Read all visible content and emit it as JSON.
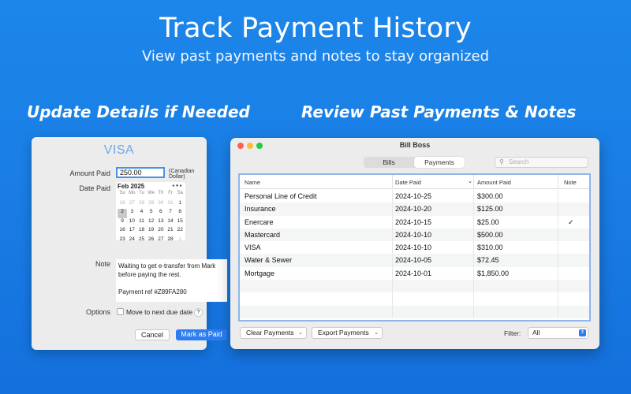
{
  "header": {
    "title": "Track Payment History",
    "subtitle": "View past payments and notes to stay organized"
  },
  "sections": {
    "left_title": "Update Details if Needed",
    "right_title": "Review Past Payments & Notes"
  },
  "details_panel": {
    "brand": "VISA",
    "amount_label": "Amount Paid",
    "amount_value": "250.00",
    "currency": "(Canadian Dollar)",
    "date_label": "Date Paid",
    "calendar": {
      "month": "Feb 2025",
      "nav": "◂ ● ▸",
      "weekdays": [
        "Su",
        "Mo",
        "Tu",
        "We",
        "Th",
        "Fr",
        "Sa"
      ],
      "days": [
        [
          "26",
          "27",
          "28",
          "29",
          "30",
          "31",
          "1"
        ],
        [
          "2",
          "3",
          "4",
          "5",
          "6",
          "7",
          "8"
        ],
        [
          "9",
          "10",
          "11",
          "12",
          "13",
          "14",
          "15"
        ],
        [
          "16",
          "17",
          "18",
          "19",
          "20",
          "21",
          "22"
        ],
        [
          "23",
          "24",
          "25",
          "26",
          "27",
          "28",
          "1"
        ]
      ],
      "selected_day": "2"
    },
    "note_label": "Note",
    "note_lines": [
      "Waiting to get e-transfer from Mark",
      "before paying the rest.",
      "",
      "Payment ref #Z89FA280"
    ],
    "options_label": "Options",
    "move_checkbox_label": "Move to next due date",
    "move_checked": false,
    "help_label": "?",
    "cancel_label": "Cancel",
    "mark_paid_label": "Mark as Paid"
  },
  "window": {
    "title": "Bill Boss",
    "tabs": [
      {
        "label": "Bills",
        "active": false
      },
      {
        "label": "Payments",
        "active": true
      }
    ],
    "search_placeholder": "Search",
    "search_icon": "magnifier-icon",
    "columns": [
      "Name",
      "Date Paid",
      "Amount Paid",
      "Note"
    ],
    "sort_indicator": "⌄",
    "rows": [
      {
        "name": "Personal Line of Credit",
        "date": "2024-10-25",
        "amount": "$300.00",
        "note": ""
      },
      {
        "name": "Insurance",
        "date": "2024-10-20",
        "amount": "$125.00",
        "note": ""
      },
      {
        "name": "Enercare",
        "date": "2024-10-15",
        "amount": "$25.00",
        "note": "✓"
      },
      {
        "name": "Mastercard",
        "date": "2024-10-10",
        "amount": "$500.00",
        "note": ""
      },
      {
        "name": "VISA",
        "date": "2024-10-10",
        "amount": "$310.00",
        "note": ""
      },
      {
        "name": "Water & Sewer",
        "date": "2024-10-05",
        "amount": "$72.45",
        "note": ""
      },
      {
        "name": "Mortgage",
        "date": "2024-10-01",
        "amount": "$1,850.00",
        "note": ""
      }
    ],
    "clear_button": "Clear Payments",
    "export_button": "Export Payments",
    "filter_label": "Filter:",
    "filter_value": "All"
  },
  "colors": {
    "background": "#1a7fe6",
    "accent": "#2c7df2",
    "brand_text": "#6aa9e6"
  }
}
